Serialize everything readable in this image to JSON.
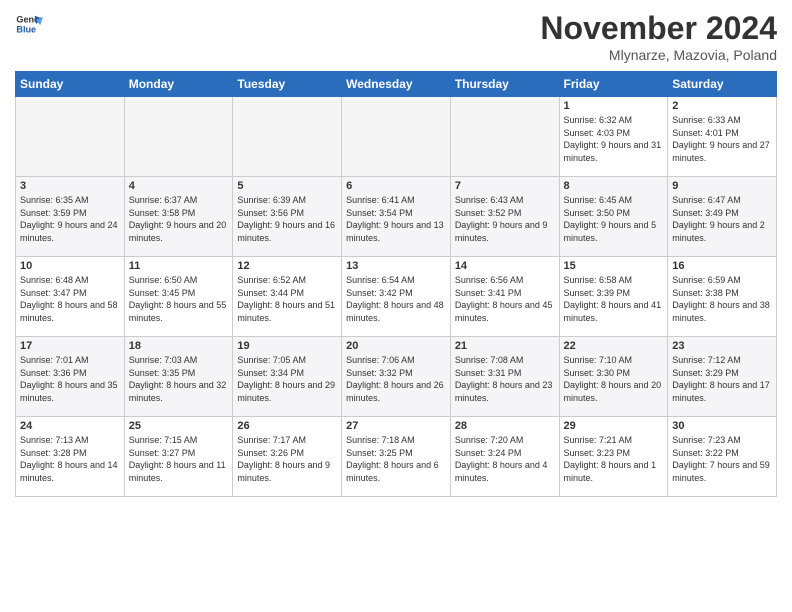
{
  "logo": {
    "line1": "General",
    "line2": "Blue"
  },
  "title": "November 2024",
  "subtitle": "Mlynarze, Mazovia, Poland",
  "headers": [
    "Sunday",
    "Monday",
    "Tuesday",
    "Wednesday",
    "Thursday",
    "Friday",
    "Saturday"
  ],
  "weeks": [
    [
      {
        "day": "",
        "info": ""
      },
      {
        "day": "",
        "info": ""
      },
      {
        "day": "",
        "info": ""
      },
      {
        "day": "",
        "info": ""
      },
      {
        "day": "",
        "info": ""
      },
      {
        "day": "1",
        "info": "Sunrise: 6:32 AM\nSunset: 4:03 PM\nDaylight: 9 hours and 31 minutes."
      },
      {
        "day": "2",
        "info": "Sunrise: 6:33 AM\nSunset: 4:01 PM\nDaylight: 9 hours and 27 minutes."
      }
    ],
    [
      {
        "day": "3",
        "info": "Sunrise: 6:35 AM\nSunset: 3:59 PM\nDaylight: 9 hours and 24 minutes."
      },
      {
        "day": "4",
        "info": "Sunrise: 6:37 AM\nSunset: 3:58 PM\nDaylight: 9 hours and 20 minutes."
      },
      {
        "day": "5",
        "info": "Sunrise: 6:39 AM\nSunset: 3:56 PM\nDaylight: 9 hours and 16 minutes."
      },
      {
        "day": "6",
        "info": "Sunrise: 6:41 AM\nSunset: 3:54 PM\nDaylight: 9 hours and 13 minutes."
      },
      {
        "day": "7",
        "info": "Sunrise: 6:43 AM\nSunset: 3:52 PM\nDaylight: 9 hours and 9 minutes."
      },
      {
        "day": "8",
        "info": "Sunrise: 6:45 AM\nSunset: 3:50 PM\nDaylight: 9 hours and 5 minutes."
      },
      {
        "day": "9",
        "info": "Sunrise: 6:47 AM\nSunset: 3:49 PM\nDaylight: 9 hours and 2 minutes."
      }
    ],
    [
      {
        "day": "10",
        "info": "Sunrise: 6:48 AM\nSunset: 3:47 PM\nDaylight: 8 hours and 58 minutes."
      },
      {
        "day": "11",
        "info": "Sunrise: 6:50 AM\nSunset: 3:45 PM\nDaylight: 8 hours and 55 minutes."
      },
      {
        "day": "12",
        "info": "Sunrise: 6:52 AM\nSunset: 3:44 PM\nDaylight: 8 hours and 51 minutes."
      },
      {
        "day": "13",
        "info": "Sunrise: 6:54 AM\nSunset: 3:42 PM\nDaylight: 8 hours and 48 minutes."
      },
      {
        "day": "14",
        "info": "Sunrise: 6:56 AM\nSunset: 3:41 PM\nDaylight: 8 hours and 45 minutes."
      },
      {
        "day": "15",
        "info": "Sunrise: 6:58 AM\nSunset: 3:39 PM\nDaylight: 8 hours and 41 minutes."
      },
      {
        "day": "16",
        "info": "Sunrise: 6:59 AM\nSunset: 3:38 PM\nDaylight: 8 hours and 38 minutes."
      }
    ],
    [
      {
        "day": "17",
        "info": "Sunrise: 7:01 AM\nSunset: 3:36 PM\nDaylight: 8 hours and 35 minutes."
      },
      {
        "day": "18",
        "info": "Sunrise: 7:03 AM\nSunset: 3:35 PM\nDaylight: 8 hours and 32 minutes."
      },
      {
        "day": "19",
        "info": "Sunrise: 7:05 AM\nSunset: 3:34 PM\nDaylight: 8 hours and 29 minutes."
      },
      {
        "day": "20",
        "info": "Sunrise: 7:06 AM\nSunset: 3:32 PM\nDaylight: 8 hours and 26 minutes."
      },
      {
        "day": "21",
        "info": "Sunrise: 7:08 AM\nSunset: 3:31 PM\nDaylight: 8 hours and 23 minutes."
      },
      {
        "day": "22",
        "info": "Sunrise: 7:10 AM\nSunset: 3:30 PM\nDaylight: 8 hours and 20 minutes."
      },
      {
        "day": "23",
        "info": "Sunrise: 7:12 AM\nSunset: 3:29 PM\nDaylight: 8 hours and 17 minutes."
      }
    ],
    [
      {
        "day": "24",
        "info": "Sunrise: 7:13 AM\nSunset: 3:28 PM\nDaylight: 8 hours and 14 minutes."
      },
      {
        "day": "25",
        "info": "Sunrise: 7:15 AM\nSunset: 3:27 PM\nDaylight: 8 hours and 11 minutes."
      },
      {
        "day": "26",
        "info": "Sunrise: 7:17 AM\nSunset: 3:26 PM\nDaylight: 8 hours and 9 minutes."
      },
      {
        "day": "27",
        "info": "Sunrise: 7:18 AM\nSunset: 3:25 PM\nDaylight: 8 hours and 6 minutes."
      },
      {
        "day": "28",
        "info": "Sunrise: 7:20 AM\nSunset: 3:24 PM\nDaylight: 8 hours and 4 minutes."
      },
      {
        "day": "29",
        "info": "Sunrise: 7:21 AM\nSunset: 3:23 PM\nDaylight: 8 hours and 1 minute."
      },
      {
        "day": "30",
        "info": "Sunrise: 7:23 AM\nSunset: 3:22 PM\nDaylight: 7 hours and 59 minutes."
      }
    ]
  ]
}
